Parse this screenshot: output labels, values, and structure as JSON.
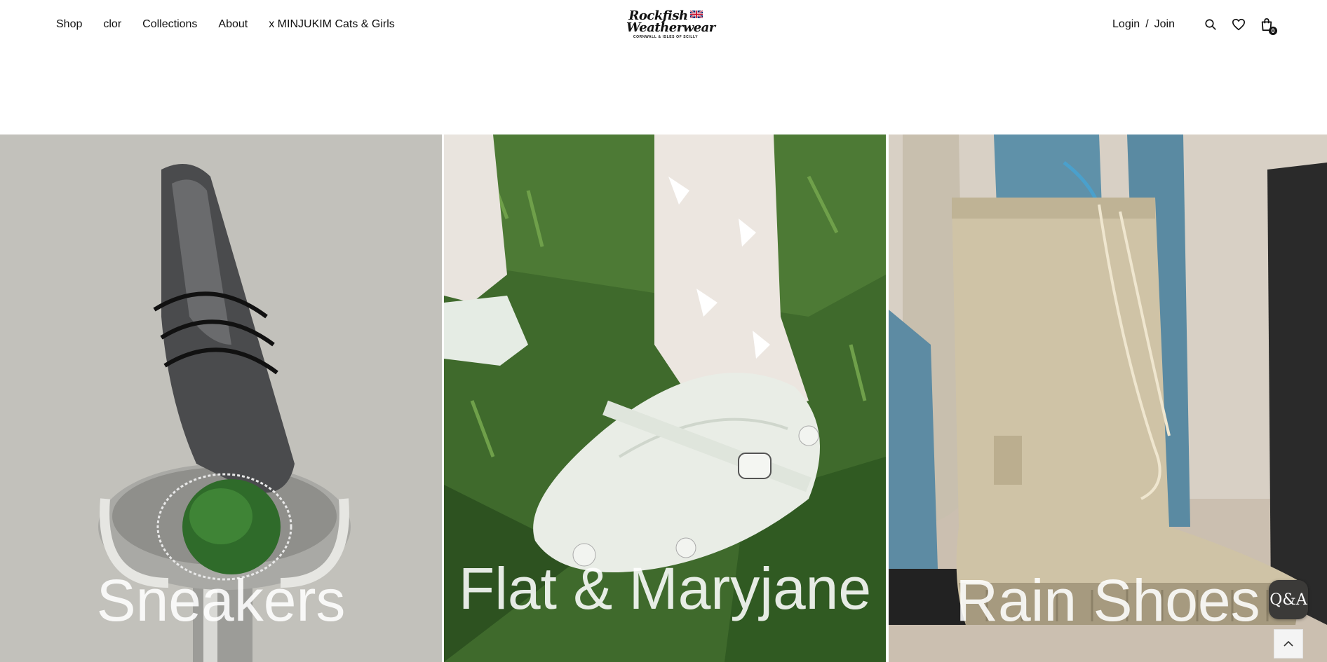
{
  "header": {
    "nav": [
      {
        "label": "Shop"
      },
      {
        "label": "clor"
      },
      {
        "label": "Collections"
      },
      {
        "label": "About"
      },
      {
        "label": "x MINJUKIM Cats & Girls"
      }
    ],
    "logo": {
      "line1": "Rockfish",
      "line2": "Weatherwear",
      "tagline": "CORNWALL & ISLES OF SCILLY"
    },
    "auth": {
      "login": "Login",
      "separator": "/",
      "join": "Join"
    },
    "icons": [
      "search-icon",
      "heart-icon",
      "shopping-bag-icon"
    ],
    "cart_count": "0"
  },
  "panels": [
    {
      "caption": "Sneakers",
      "bg_color": "#bdbcb6"
    },
    {
      "caption": "Flat & Maryjane",
      "bg_color": "#3f6a2c"
    },
    {
      "caption": "Rain Shoes",
      "bg_color": "#cdc3b5"
    }
  ],
  "floating": {
    "qa_label": "Q&A",
    "scroll_top_icon": "chevron-up-icon"
  }
}
